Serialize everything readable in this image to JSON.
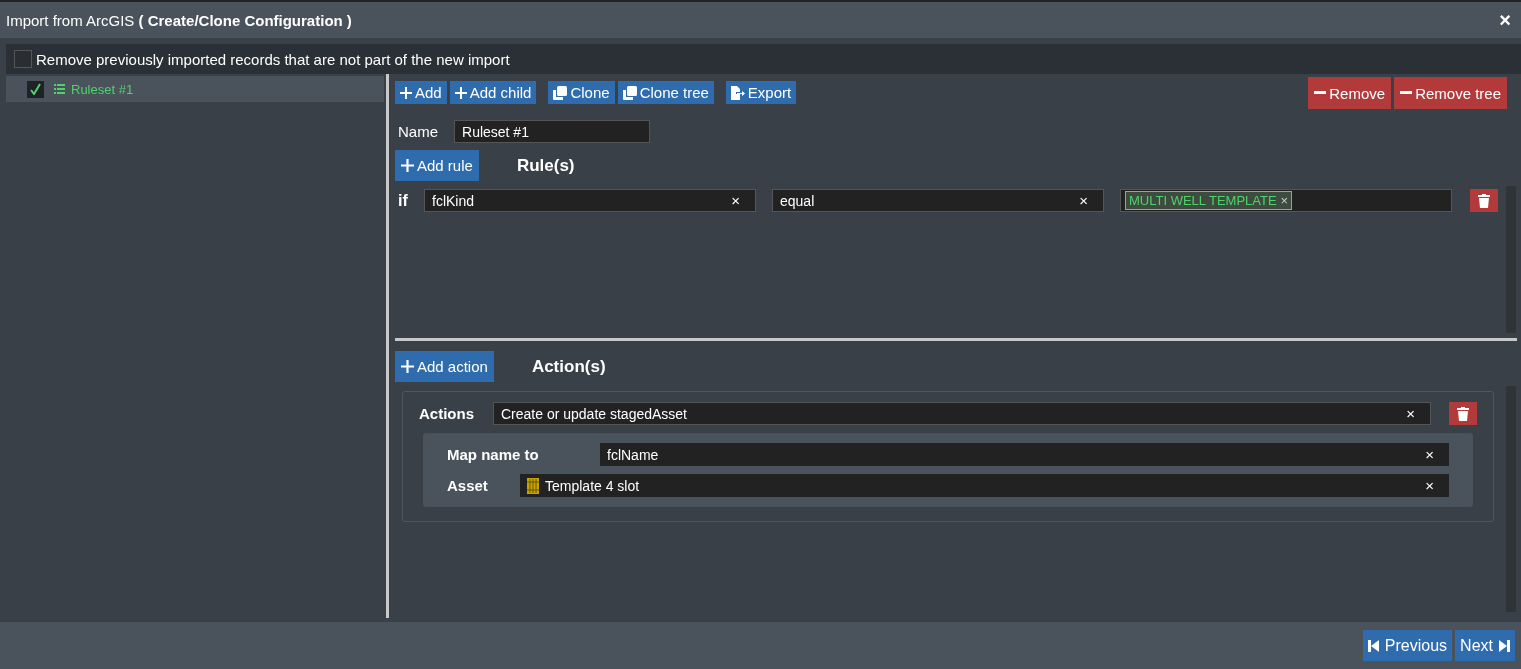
{
  "window": {
    "title": "Import from ArcGIS",
    "subtitle": "( Create/Clone Configuration )",
    "close": "×"
  },
  "remove_previous": {
    "label": "Remove previously imported records that are not part of the new import",
    "checked": false
  },
  "tree": [
    {
      "label": "Ruleset #1",
      "checked": true,
      "selected": true
    }
  ],
  "toolbar": {
    "left": [
      [
        {
          "label": "Add",
          "kind": "plus"
        },
        {
          "label": "Add child",
          "kind": "plus"
        }
      ],
      [
        {
          "label": "Clone",
          "kind": "clone"
        },
        {
          "label": "Clone tree",
          "kind": "clone"
        }
      ],
      [
        {
          "label": "Export",
          "kind": "export"
        }
      ]
    ],
    "right": [
      {
        "label": "Remove",
        "kind": "minus"
      },
      {
        "label": "Remove tree",
        "kind": "minus"
      }
    ]
  },
  "name": {
    "label": "Name",
    "value": "Ruleset #1"
  },
  "rules": {
    "add_label": "Add rule",
    "heading": "Rule(s)",
    "items": [
      {
        "keyword": "if",
        "field": "fclKind",
        "field_clear": "×",
        "operator": "equal",
        "operator_clear": "×",
        "values": [
          {
            "label": "MULTI WELL TEMPLATE",
            "remove": "×"
          }
        ]
      }
    ]
  },
  "actions": {
    "add_label": "Add action",
    "heading": "Action(s)",
    "items": [
      {
        "label": "Actions",
        "value": "Create or update stagedAsset",
        "clear": "×",
        "mappings": [
          {
            "label": "Map name to",
            "value": "fclName",
            "clear": "×",
            "kind": "text"
          },
          {
            "label": "Asset",
            "value": "Template 4 slot",
            "clear": "×",
            "kind": "asset"
          }
        ]
      }
    ]
  },
  "footer": [
    {
      "label": "Previous",
      "kind": "first"
    },
    {
      "label": "Next",
      "kind": "last"
    }
  ]
}
